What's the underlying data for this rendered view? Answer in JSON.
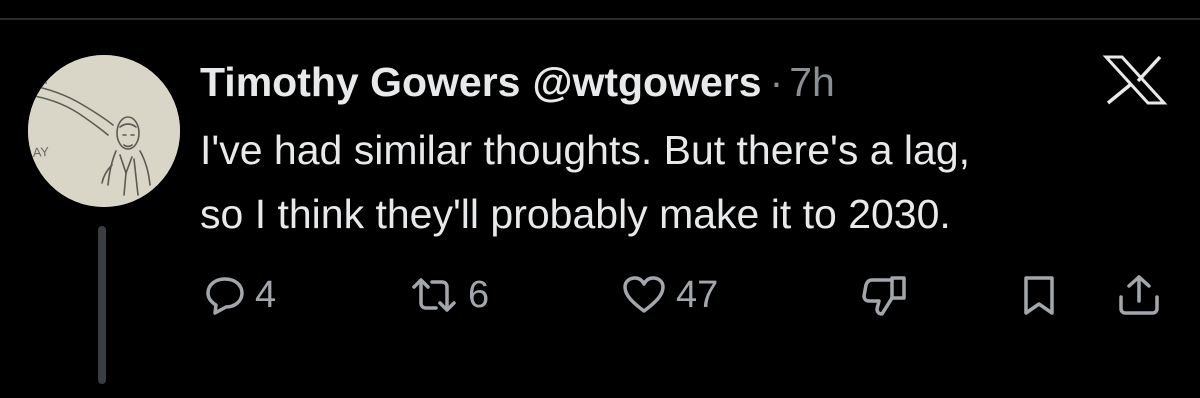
{
  "tweet": {
    "author_name": "Timothy Gowers",
    "author_handle": "@wtgowers",
    "separator": "·",
    "timestamp": "7h",
    "text_lines": [
      "I've had similar thoughts. But there's a lag,",
      "so I think they'll probably make it to 2030."
    ]
  },
  "actions": {
    "replies": "4",
    "reposts": "6",
    "likes": "47"
  },
  "avatar_sketch_text": "AY",
  "icons": {
    "logo": "x-logo-icon",
    "reply": "reply-icon",
    "repost": "repost-icon",
    "like": "heart-icon",
    "dislike": "thumbs-down-icon",
    "bookmark": "bookmark-icon",
    "share": "share-icon"
  },
  "colors": {
    "background": "#000000",
    "text": "#e7e9ea",
    "muted": "#8b8f94",
    "icon": "#a3a7ab"
  }
}
